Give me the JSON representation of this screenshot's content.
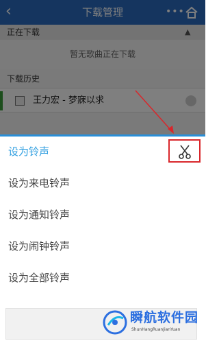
{
  "background": {
    "title": "下载管理",
    "back_icon": "chevron-left-icon",
    "more_icon": "more-dots-icon",
    "home_icon": "home-icon",
    "section_downloading": "正在下载",
    "empty_message": "暂无歌曲正在下载",
    "section_history": "下载历史",
    "history_items": [
      {
        "title": "王力宏 - 梦寐以求"
      }
    ]
  },
  "sheet": {
    "items": [
      {
        "label": "设为铃声"
      },
      {
        "label": "设为来电铃声"
      },
      {
        "label": "设为通知铃声"
      },
      {
        "label": "设为闹钟铃声"
      },
      {
        "label": "设为全部铃声"
      }
    ],
    "cut_icon": "scissors-icon"
  },
  "colors": {
    "accent": "#2e9ee0",
    "titlebar": "#2a6bbf",
    "highlight_box": "#d9262b"
  },
  "watermark": {
    "text": "瞬航软件园",
    "subtext": "ShunHangRuanJianYuan"
  }
}
